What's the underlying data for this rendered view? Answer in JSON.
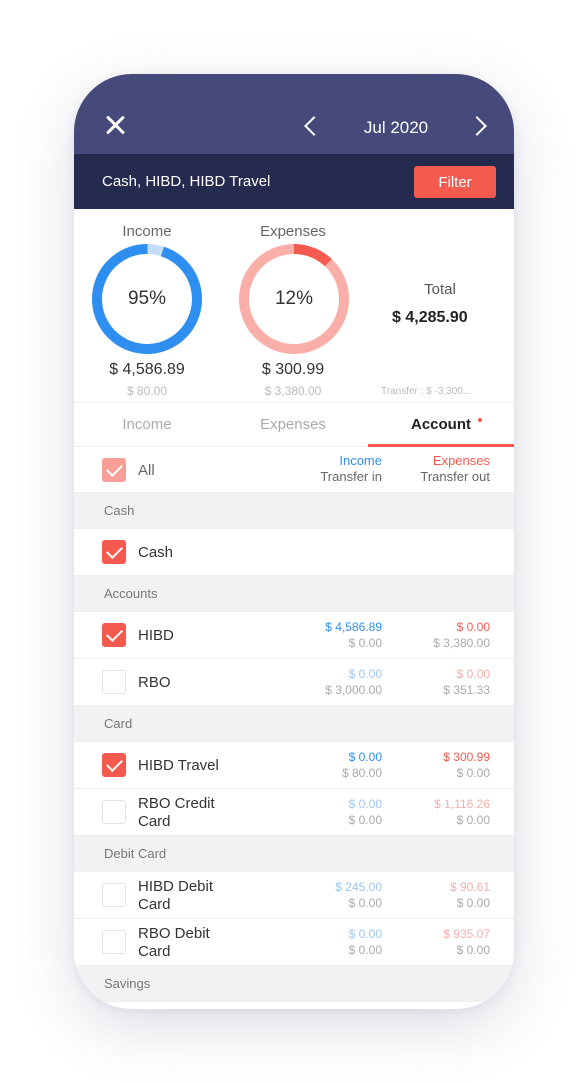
{
  "header": {
    "month": "Jul 2020"
  },
  "filter": {
    "accounts": "Cash, HIBD, HIBD Travel",
    "button": "Filter"
  },
  "summary": {
    "income": {
      "label": "Income",
      "percent": "95%",
      "fraction": 0.95,
      "amount": "$ 4,586.89",
      "transfer": "$ 80.00"
    },
    "expenses": {
      "label": "Expenses",
      "percent": "12%",
      "fraction": 0.12,
      "amount": "$ 300.99",
      "transfer": "$ 3,380.00"
    },
    "total": {
      "label": "Total",
      "amount": "$ 4,285.90",
      "transfer": "Transfer : $ -3,300..."
    }
  },
  "tabs": [
    {
      "label": "Income"
    },
    {
      "label": "Expenses"
    },
    {
      "label": "Account"
    }
  ],
  "list_header": {
    "all_label": "All",
    "income": "Income",
    "transfer_in": "Transfer in",
    "expenses": "Expenses",
    "transfer_out": "Transfer out"
  },
  "sections": [
    {
      "title": "Cash",
      "rows": [
        {
          "name": "Cash",
          "checked": true
        }
      ]
    },
    {
      "title": "Accounts",
      "rows": [
        {
          "name": "HIBD",
          "checked": true,
          "income": "$ 4,586.89",
          "transfer_in": "$ 0.00",
          "expenses": "$ 0.00",
          "transfer_out": "$ 3,380.00"
        },
        {
          "name": "RBO",
          "checked": false,
          "income": "$ 0.00",
          "transfer_in": "$ 3,000.00",
          "expenses": "$ 0.00",
          "transfer_out": "$ 351.33"
        }
      ]
    },
    {
      "title": "Card",
      "rows": [
        {
          "name": "HIBD Travel",
          "checked": true,
          "income": "$ 0.00",
          "transfer_in": "$ 80.00",
          "expenses": "$ 300.99",
          "transfer_out": "$ 0.00"
        },
        {
          "name_line1": "RBO Credit",
          "name_line2": "Card",
          "checked": false,
          "income": "$ 0.00",
          "transfer_in": "$ 0.00",
          "expenses": "$ 1,116.26",
          "transfer_out": "$ 0.00"
        }
      ]
    },
    {
      "title": "Debit Card",
      "rows": [
        {
          "name_line1": "HIBD Debit",
          "name_line2": "Card",
          "checked": false,
          "income": "$ 245.00",
          "transfer_in": "$ 0.00",
          "expenses": "$ 90.61",
          "transfer_out": "$ 0.00"
        },
        {
          "name_line1": "RBO Debit",
          "name_line2": "Card",
          "checked": false,
          "income": "$ 0.00",
          "transfer_in": "$ 0.00",
          "expenses": "$ 935.07",
          "transfer_out": "$ 0.00"
        }
      ]
    },
    {
      "title": "Savings",
      "rows": []
    }
  ],
  "colors": {
    "header": "#454a7a",
    "filterbar": "#252a4f",
    "accent": "#f45a4e",
    "income_blue": "#2f8ff0",
    "expense_salmon": "#f9aea8"
  }
}
